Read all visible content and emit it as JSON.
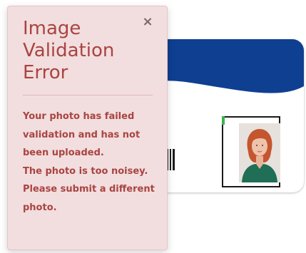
{
  "popover": {
    "title": "Image Validation Error",
    "close_glyph": "×",
    "close_icon": "close-icon",
    "message_lines": [
      "Your photo has failed validation and has not been uploaded.",
      "The photo is too noisey.",
      "Please submit a different photo."
    ]
  },
  "card": {
    "accent_color": "#0f3f91",
    "frame_marker_color": "#3bb34a"
  },
  "colors": {
    "popover_background": "#f2dede",
    "popover_text": "#a94442"
  }
}
